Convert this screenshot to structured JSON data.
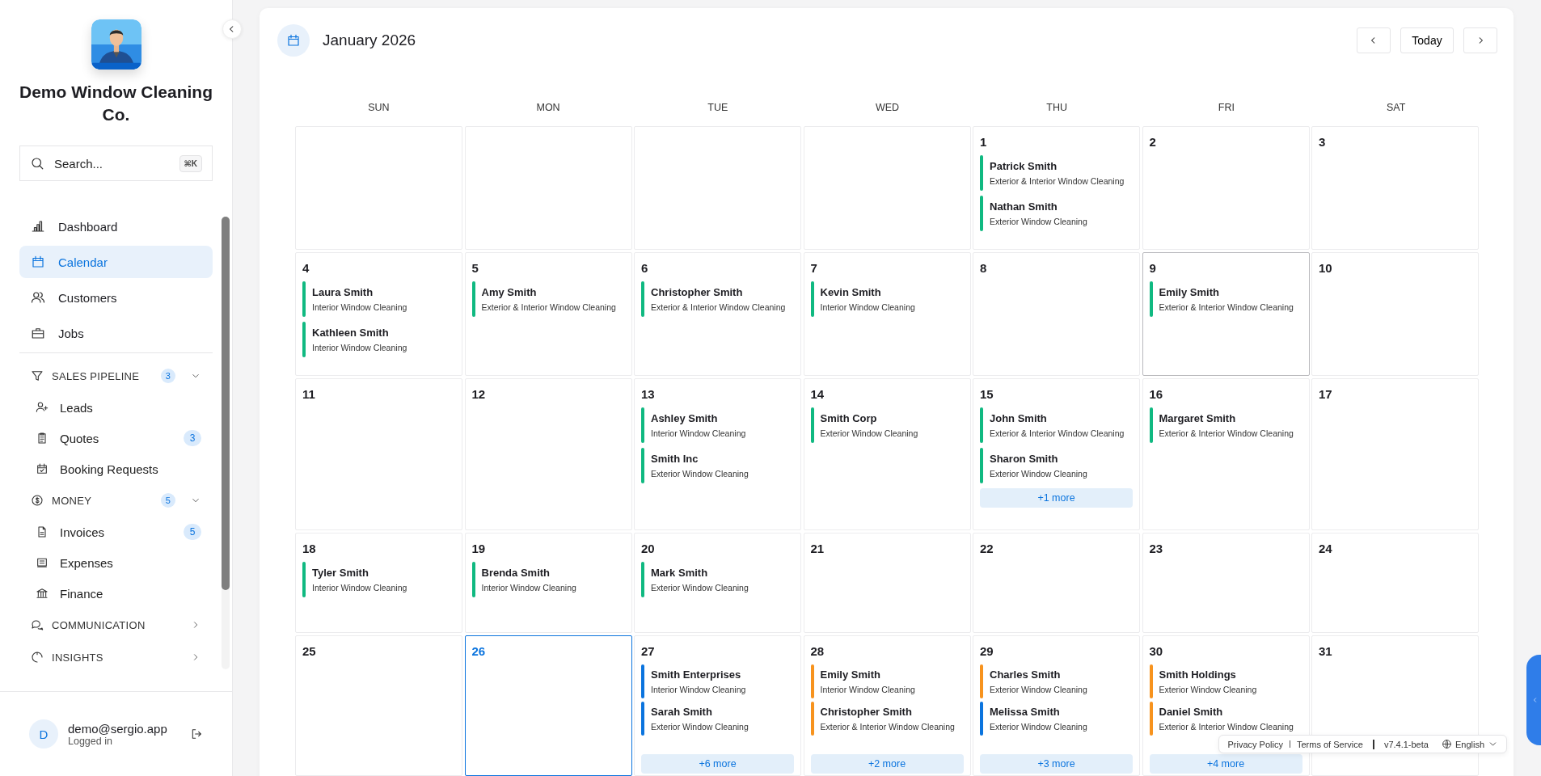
{
  "sidebar": {
    "company": "Demo Window Cleaning Co.",
    "search": {
      "placeholder": "Search...",
      "shortcut": "⌘K"
    },
    "nav": [
      {
        "label": "Dashboard",
        "selected": false
      },
      {
        "label": "Calendar",
        "selected": true
      },
      {
        "label": "Customers",
        "selected": false
      },
      {
        "label": "Jobs",
        "selected": false
      }
    ],
    "groups": [
      {
        "label": "SALES PIPELINE",
        "badge": "3",
        "expanded": true,
        "children": [
          {
            "label": "Leads",
            "selected": false
          },
          {
            "label": "Quotes",
            "badge": "3",
            "selected": false
          },
          {
            "label": "Booking Requests",
            "selected": false
          }
        ]
      },
      {
        "label": "MONEY",
        "badge": "5",
        "expanded": true,
        "children": [
          {
            "label": "Invoices",
            "badge": "5",
            "selected": false
          },
          {
            "label": "Expenses",
            "selected": false
          },
          {
            "label": "Finance",
            "selected": false
          }
        ]
      },
      {
        "label": "COMMUNICATION",
        "expanded": false
      },
      {
        "label": "INSIGHTS",
        "expanded": false
      }
    ],
    "user": {
      "initial": "D",
      "email": "demo@sergio.app",
      "status": "Logged in"
    }
  },
  "calendar": {
    "title": "January 2026",
    "today_button": "Today",
    "weekdays": [
      "SUN",
      "MON",
      "TUE",
      "WED",
      "THU",
      "FRI",
      "SAT"
    ],
    "weeks": [
      [
        {
          "kind": "blank"
        },
        {
          "kind": "blank"
        },
        {
          "kind": "blank"
        },
        {
          "kind": "blank"
        },
        {
          "kind": "day",
          "day": "1",
          "today": false,
          "selected": false,
          "events": [
            {
              "name": "Patrick Smith",
              "service": "Exterior & Interior Window Cleaning",
              "color": "#10b981"
            },
            {
              "name": "Nathan Smith",
              "service": "Exterior Window Cleaning",
              "color": "#10b981"
            }
          ]
        },
        {
          "kind": "day",
          "day": "2",
          "today": false,
          "selected": false
        },
        {
          "kind": "day",
          "day": "3",
          "today": false,
          "selected": false
        }
      ],
      [
        {
          "kind": "day",
          "day": "4",
          "today": false,
          "selected": false,
          "events": [
            {
              "name": "Laura Smith",
              "service": "Interior Window Cleaning",
              "color": "#10b981"
            },
            {
              "name": "Kathleen Smith",
              "service": "Interior Window Cleaning",
              "color": "#10b981"
            }
          ]
        },
        {
          "kind": "day",
          "day": "5",
          "today": false,
          "selected": false,
          "events": [
            {
              "name": "Amy Smith",
              "service": "Exterior & Interior Window Cleaning",
              "color": "#10b981"
            }
          ]
        },
        {
          "kind": "day",
          "day": "6",
          "today": false,
          "selected": false,
          "events": [
            {
              "name": "Christopher Smith",
              "service": "Exterior & Interior Window Cleaning",
              "color": "#10b981"
            }
          ]
        },
        {
          "kind": "day",
          "day": "7",
          "today": false,
          "selected": false,
          "events": [
            {
              "name": "Kevin Smith",
              "service": "Interior Window Cleaning",
              "color": "#10b981"
            }
          ]
        },
        {
          "kind": "day",
          "day": "8",
          "today": false,
          "selected": false
        },
        {
          "kind": "day",
          "day": "9",
          "today": false,
          "selected": true,
          "events": [
            {
              "name": "Emily Smith",
              "service": "Exterior & Interior Window Cleaning",
              "color": "#10b981"
            }
          ]
        },
        {
          "kind": "day",
          "day": "10",
          "today": false,
          "selected": false
        }
      ],
      [
        {
          "kind": "day",
          "day": "11",
          "today": false,
          "selected": false
        },
        {
          "kind": "day",
          "day": "12",
          "today": false,
          "selected": false
        },
        {
          "kind": "day",
          "day": "13",
          "today": false,
          "selected": false,
          "events": [
            {
              "name": "Ashley Smith",
              "service": "Interior Window Cleaning",
              "color": "#10b981"
            },
            {
              "name": "Smith Inc",
              "service": "Exterior Window Cleaning",
              "color": "#10b981"
            }
          ]
        },
        {
          "kind": "day",
          "day": "14",
          "today": false,
          "selected": false,
          "events": [
            {
              "name": "Smith Corp",
              "service": "Exterior Window Cleaning",
              "color": "#10b981"
            }
          ]
        },
        {
          "kind": "day",
          "day": "15",
          "today": false,
          "selected": false,
          "events": [
            {
              "name": "John Smith",
              "service": "Exterior & Interior Window Cleaning",
              "color": "#10b981"
            },
            {
              "name": "Sharon Smith",
              "service": "Exterior Window Cleaning",
              "color": "#10b981"
            }
          ],
          "more": "+1 more"
        },
        {
          "kind": "day",
          "day": "16",
          "today": false,
          "selected": false,
          "events": [
            {
              "name": "Margaret Smith",
              "service": "Exterior & Interior Window Cleaning",
              "color": "#10b981"
            }
          ]
        },
        {
          "kind": "day",
          "day": "17",
          "today": false,
          "selected": false
        }
      ],
      [
        {
          "kind": "day",
          "day": "18",
          "today": false,
          "selected": false,
          "events": [
            {
              "name": "Tyler Smith",
              "service": "Interior Window Cleaning",
              "color": "#10b981"
            }
          ]
        },
        {
          "kind": "day",
          "day": "19",
          "today": false,
          "selected": false,
          "events": [
            {
              "name": "Brenda Smith",
              "service": "Interior Window Cleaning",
              "color": "#10b981"
            }
          ]
        },
        {
          "kind": "day",
          "day": "20",
          "today": false,
          "selected": false,
          "events": [
            {
              "name": "Mark Smith",
              "service": "Exterior Window Cleaning",
              "color": "#10b981"
            }
          ]
        },
        {
          "kind": "day",
          "day": "21",
          "today": false,
          "selected": false
        },
        {
          "kind": "day",
          "day": "22",
          "today": false,
          "selected": false
        },
        {
          "kind": "day",
          "day": "23",
          "today": false,
          "selected": false
        },
        {
          "kind": "day",
          "day": "24",
          "today": false,
          "selected": false
        }
      ],
      [
        {
          "kind": "day",
          "day": "25",
          "today": false,
          "selected": false
        },
        {
          "kind": "day",
          "day": "26",
          "today": true,
          "selected": false
        },
        {
          "kind": "day",
          "day": "27",
          "today": false,
          "selected": false,
          "events": [
            {
              "name": "Smith Enterprises",
              "service": "Interior Window Cleaning",
              "color": "#0b74de"
            },
            {
              "name": "Sarah Smith",
              "service": "Exterior Window Cleaning",
              "color": "#0b74de"
            }
          ],
          "more": "+6 more"
        },
        {
          "kind": "day",
          "day": "28",
          "today": false,
          "selected": false,
          "events": [
            {
              "name": "Emily Smith",
              "service": "Interior Window Cleaning",
              "color": "#f7931e"
            },
            {
              "name": "Christopher Smith",
              "service": "Exterior & Interior Window Cleaning",
              "color": "#f7931e"
            }
          ],
          "more": "+2 more"
        },
        {
          "kind": "day",
          "day": "29",
          "today": false,
          "selected": false,
          "events": [
            {
              "name": "Charles Smith",
              "service": "Exterior Window Cleaning",
              "color": "#f7931e"
            },
            {
              "name": "Melissa Smith",
              "service": "Exterior Window Cleaning",
              "color": "#0b74de"
            }
          ],
          "more": "+3 more"
        },
        {
          "kind": "day",
          "day": "30",
          "today": false,
          "selected": false,
          "events": [
            {
              "name": "Smith Holdings",
              "service": "Exterior Window Cleaning",
              "color": "#f7931e"
            },
            {
              "name": "Daniel Smith",
              "service": "Exterior & Interior Window Cleaning",
              "color": "#f7931e"
            }
          ],
          "more": "+4 more"
        },
        {
          "kind": "day",
          "day": "31",
          "today": false,
          "selected": false
        }
      ]
    ]
  },
  "footer": {
    "links": [
      "Privacy Policy",
      "Terms of Service"
    ],
    "version": "v7.4.1-beta",
    "language": "English"
  }
}
